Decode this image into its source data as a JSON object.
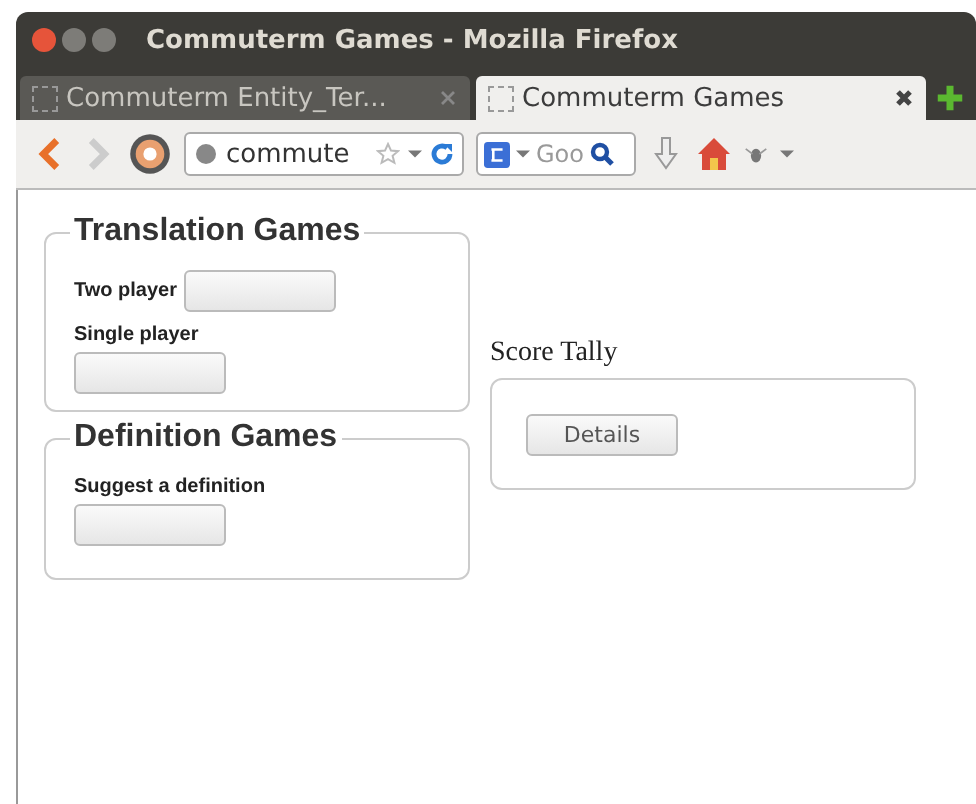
{
  "window": {
    "title": "Commuterm Games - Mozilla Firefox"
  },
  "tabs": [
    {
      "label": "Commuterm Entity_Ter...",
      "selected": false
    },
    {
      "label": "Commuterm Games",
      "selected": true
    }
  ],
  "address_bar": {
    "value": "commute"
  },
  "search": {
    "placeholder": "Goo"
  },
  "sections": [
    {
      "legend": "Translation Games",
      "items": [
        {
          "label": "Two player",
          "kind": "inline"
        },
        {
          "label": "Single player",
          "kind": "stacked"
        }
      ]
    },
    {
      "legend": "Definition Games",
      "items": [
        {
          "label": "Suggest a definition",
          "kind": "stacked"
        }
      ]
    }
  ],
  "score_tally": {
    "heading": "Score Tally",
    "button": "Details"
  }
}
